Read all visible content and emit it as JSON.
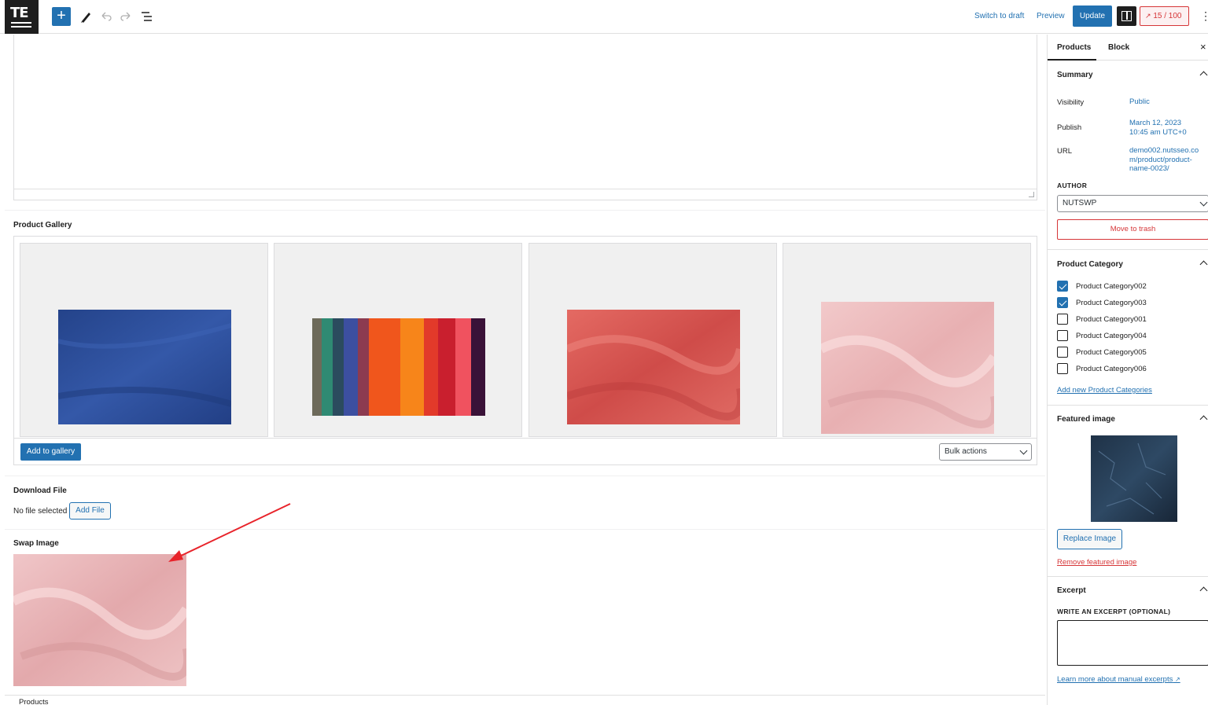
{
  "app": {
    "logo_text": "TE"
  },
  "toolbar": {
    "add_label": "+",
    "switch_to_draft": "Switch to draft",
    "preview": "Preview",
    "update": "Update",
    "score": "15 / 100",
    "more": "⋮"
  },
  "main": {
    "product_gallery_title": "Product Gallery",
    "gallery_images": [
      {
        "name": "blue fabric",
        "color": "#2c4c97"
      },
      {
        "name": "multicolor fabrics",
        "color": "#f05a1a"
      },
      {
        "name": "coral fabric",
        "color": "#d85a55"
      },
      {
        "name": "pink fabric",
        "color": "#ecbcbd"
      }
    ],
    "add_to_gallery": "Add to gallery",
    "bulk_actions": "Bulk actions",
    "download_file_title": "Download File",
    "no_file_selected": "No file selected",
    "add_file": "Add File",
    "swap_image_title": "Swap Image",
    "products_footer": "Products"
  },
  "sidebar": {
    "tabs": [
      "Products",
      "Block"
    ],
    "close": "×",
    "summary": {
      "title": "Summary",
      "visibility_label": "Visibility",
      "visibility_value": "Public",
      "publish_label": "Publish",
      "publish_value_1": "March 12, 2023",
      "publish_value_2": "10:45 am UTC+0",
      "url_label": "URL",
      "url_value_1": "demo002.nutsseo.co",
      "url_value_2": "m/product/product-",
      "url_value_3": "name-0023/",
      "author_label": "AUTHOR",
      "author_value": "NUTSWP",
      "move_to_trash": "Move to trash"
    },
    "category": {
      "title": "Product Category",
      "items": [
        {
          "label": "Product Category002",
          "checked": true
        },
        {
          "label": "Product Category003",
          "checked": true
        },
        {
          "label": "Product Category001",
          "checked": false
        },
        {
          "label": "Product Category004",
          "checked": false
        },
        {
          "label": "Product Category005",
          "checked": false
        },
        {
          "label": "Product Category006",
          "checked": false
        }
      ],
      "add_new": "Add new Product Categories"
    },
    "featured": {
      "title": "Featured image",
      "replace": "Replace Image",
      "remove": "Remove featured image"
    },
    "excerpt": {
      "title": "Excerpt",
      "label": "WRITE AN EXCERPT (OPTIONAL)",
      "learn_more": "Learn more about manual excerpts"
    }
  },
  "colors": {
    "accent": "#2271b1",
    "danger": "#d63638",
    "arrow": "#e8232a"
  }
}
